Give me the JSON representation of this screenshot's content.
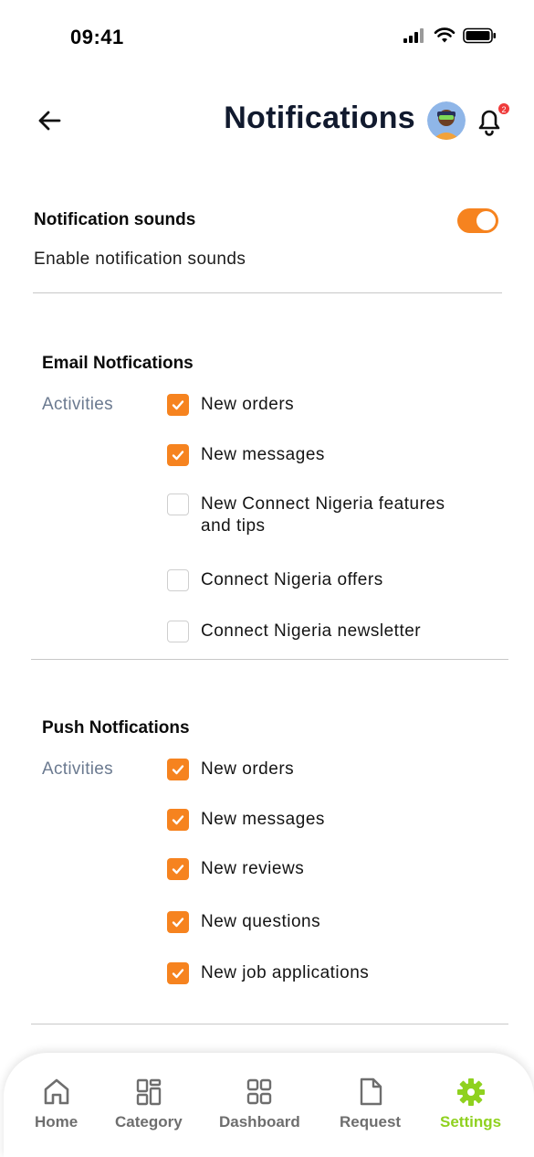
{
  "status_bar": {
    "time": "09:41"
  },
  "header": {
    "title": "Notifications",
    "notification_count": "2"
  },
  "sound": {
    "title": "Notification sounds",
    "subtitle": "Enable notification sounds",
    "enabled": true
  },
  "email": {
    "title": "Email Notfications",
    "activities_label": "Activities",
    "options": [
      {
        "label": "New orders",
        "checked": true
      },
      {
        "label": "New messages",
        "checked": true
      },
      {
        "label": "New Connect Nigeria features",
        "label2": "and tips",
        "checked": false
      },
      {
        "label": "Connect Nigeria offers",
        "checked": false
      },
      {
        "label": "Connect Nigeria newsletter",
        "checked": false
      }
    ]
  },
  "push": {
    "title": "Push Notfications",
    "activities_label": "Activities",
    "options": [
      {
        "label": "New orders",
        "checked": true
      },
      {
        "label": "New messages",
        "checked": true
      },
      {
        "label": "New reviews",
        "checked": true
      },
      {
        "label": "New questions",
        "checked": true
      },
      {
        "label": "New job applications",
        "checked": true
      }
    ]
  },
  "nav": {
    "items": [
      {
        "label": "Home",
        "icon": "home-icon"
      },
      {
        "label": "Category",
        "icon": "category-icon"
      },
      {
        "label": "Dashboard",
        "icon": "dashboard-icon"
      },
      {
        "label": "Request",
        "icon": "document-icon"
      },
      {
        "label": "Settings",
        "icon": "gear-icon",
        "active": true
      }
    ]
  },
  "colors": {
    "accent": "#f6831f",
    "active_nav": "#8fd11f",
    "muted": "#6b7a90"
  }
}
